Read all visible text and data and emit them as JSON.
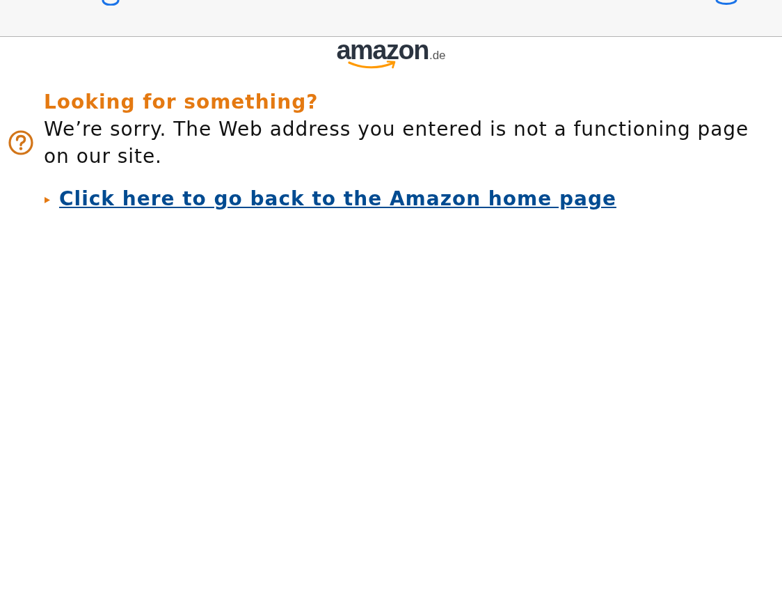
{
  "logo": {
    "wordmark": "amazon",
    "suffix": ".de"
  },
  "heading": "Looking for something?",
  "message": "We’re sorry. The Web address you entered is not a functioning page on our site.",
  "link": {
    "text": "Click here to go back to the Amazon home page"
  }
}
